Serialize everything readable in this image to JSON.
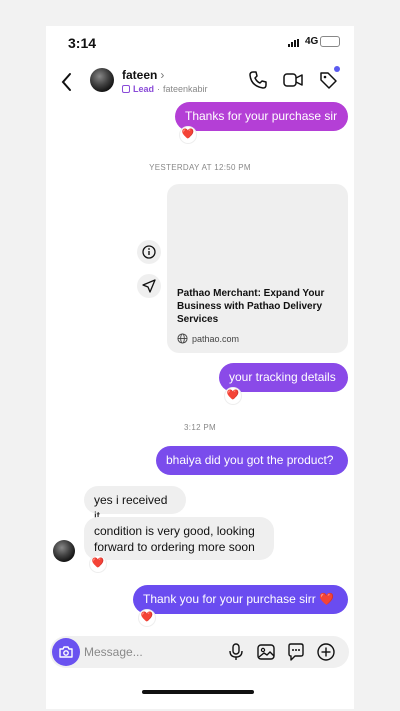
{
  "status_bar": {
    "time": "3:14",
    "network": "4G",
    "battery": "57",
    "battery_level": 0.57
  },
  "header": {
    "back_icon": "chevron-left-icon",
    "contact_name": "fateen",
    "name_chevron": "›",
    "lead_label": "Lead",
    "separator": "·",
    "username": "fateenkabir",
    "actions": [
      "phone-icon",
      "video-icon",
      "tag-icon"
    ],
    "accent": "#5b5bf0"
  },
  "messages": {
    "m1": {
      "text": "Thanks for your purchase sir",
      "reaction": "❤️"
    },
    "stamp1": "YESTERDAY AT 12:50 PM",
    "link_card": {
      "title": "Pathao Merchant: Expand Your Business with Pathao Delivery Services",
      "domain": "pathao.com"
    },
    "m2": {
      "text": "your tracking details",
      "reaction": "❤️"
    },
    "stamp2": "3:12 PM",
    "m3": {
      "text": "bhaiya did you got the product?"
    },
    "m4": {
      "text": "yes i received it"
    },
    "m5": {
      "text": "condition is very good, looking forward to ordering more soon",
      "reaction": "❤️"
    },
    "m6": {
      "text": "Thank you for your purchase sirr ❤️",
      "reaction": "❤️"
    }
  },
  "composer": {
    "placeholder": "Message...",
    "icons": [
      "camera-icon",
      "mic-icon",
      "gallery-icon",
      "sticker-icon",
      "plus-icon"
    ]
  },
  "colors": {
    "bubble_top": "#b43fd6",
    "bubble_mid": "#8a4ae8",
    "bubble_bottom": "#6a4cf0",
    "incoming": "#efefef"
  }
}
